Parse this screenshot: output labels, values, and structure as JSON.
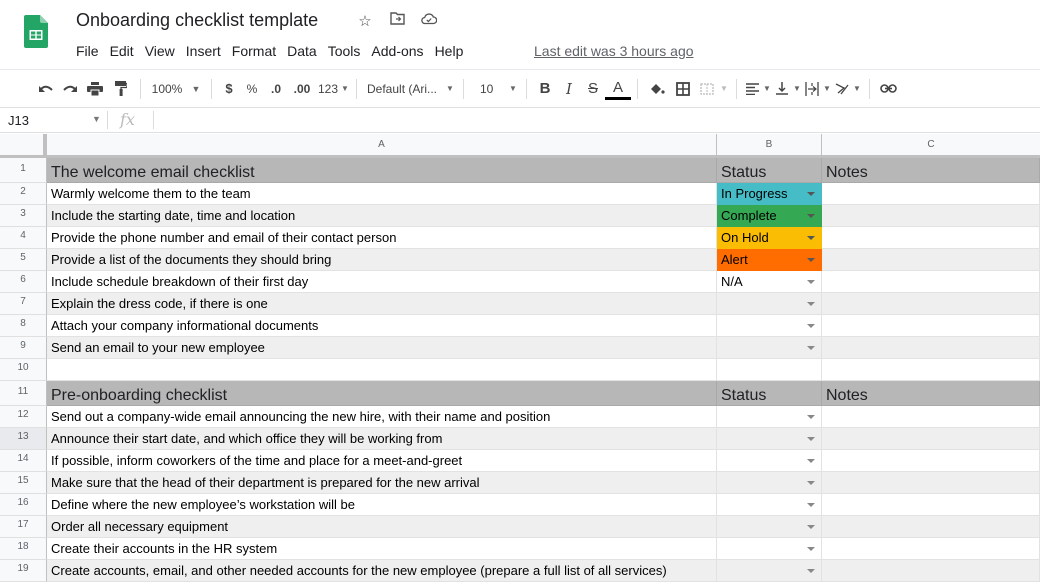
{
  "app": {
    "title": "Onboarding checklist template",
    "title_icons": [
      "star-icon",
      "move-to-folder-icon",
      "cloud-status-icon"
    ],
    "menu": [
      "File",
      "Edit",
      "View",
      "Insert",
      "Format",
      "Data",
      "Tools",
      "Add-ons",
      "Help"
    ],
    "last_edit": "Last edit was 3 hours ago"
  },
  "toolbar": {
    "zoom": "100%",
    "currency": "$",
    "percent": "%",
    "decrease_decimal": ".0",
    "increase_decimal": ".00",
    "more_formats": "123",
    "font": "Default (Ari...",
    "font_size": "10",
    "bold": "B",
    "italic": "I",
    "strikethrough": "S",
    "text_color": "A"
  },
  "formula_bar": {
    "cell_ref": "J13",
    "fx": "fx",
    "value": ""
  },
  "columns": [
    "A",
    "B",
    "C"
  ],
  "status_colors": {
    "In Progress": "#46bdc6",
    "Complete": "#34a853",
    "On Hold": "#fbbc04",
    "Alert": "#ff6d01"
  },
  "rows": [
    {
      "num": "1",
      "type": "section",
      "a": "The welcome email checklist",
      "b": "Status",
      "c": "Notes"
    },
    {
      "num": "2",
      "a": "Warmly welcome them to the team",
      "b": "In Progress",
      "dropdown": true
    },
    {
      "num": "3",
      "a": "Include the starting date, time and location",
      "b": "Complete",
      "dropdown": true
    },
    {
      "num": "4",
      "a": "Provide the phone number and email of their contact person",
      "b": "On Hold",
      "dropdown": true
    },
    {
      "num": "5",
      "a": "Provide a list of the documents they should bring",
      "b": "Alert",
      "dropdown": true
    },
    {
      "num": "6",
      "a": "Include schedule breakdown of their first day",
      "b": "N/A",
      "dropdown": true
    },
    {
      "num": "7",
      "a": "Explain the dress code, if there is one",
      "b": "",
      "dropdown": true
    },
    {
      "num": "8",
      "a": "Attach your company informational documents",
      "b": "",
      "dropdown": true
    },
    {
      "num": "9",
      "a": "Send an email to your new employee",
      "b": "",
      "dropdown": true
    },
    {
      "num": "10",
      "a": "",
      "b": "",
      "dropdown": false
    },
    {
      "num": "11",
      "type": "section",
      "a": "Pre-onboarding checklist",
      "b": "Status",
      "c": "Notes"
    },
    {
      "num": "12",
      "a": "Send out a company-wide email announcing the new hire, with their name and position",
      "b": "",
      "dropdown": true
    },
    {
      "num": "13",
      "a": "Announce their start date, and which office they will be working from",
      "b": "",
      "dropdown": true,
      "selected": true
    },
    {
      "num": "14",
      "a": "If possible, inform coworkers of the time and place for a meet-and-greet",
      "b": "",
      "dropdown": true
    },
    {
      "num": "15",
      "a": "Make sure that the head of their department is prepared for the new arrival",
      "b": "",
      "dropdown": true
    },
    {
      "num": "16",
      "a": "Define where the new employee’s workstation will be",
      "b": "",
      "dropdown": true
    },
    {
      "num": "17",
      "a": "Order all necessary equipment",
      "b": "",
      "dropdown": true
    },
    {
      "num": "18",
      "a": "Create their accounts in the HR system",
      "b": "",
      "dropdown": true
    },
    {
      "num": "19",
      "a": "Create accounts, email, and other needed accounts for the new employee (prepare a full list of all services)",
      "b": "",
      "dropdown": true
    }
  ]
}
